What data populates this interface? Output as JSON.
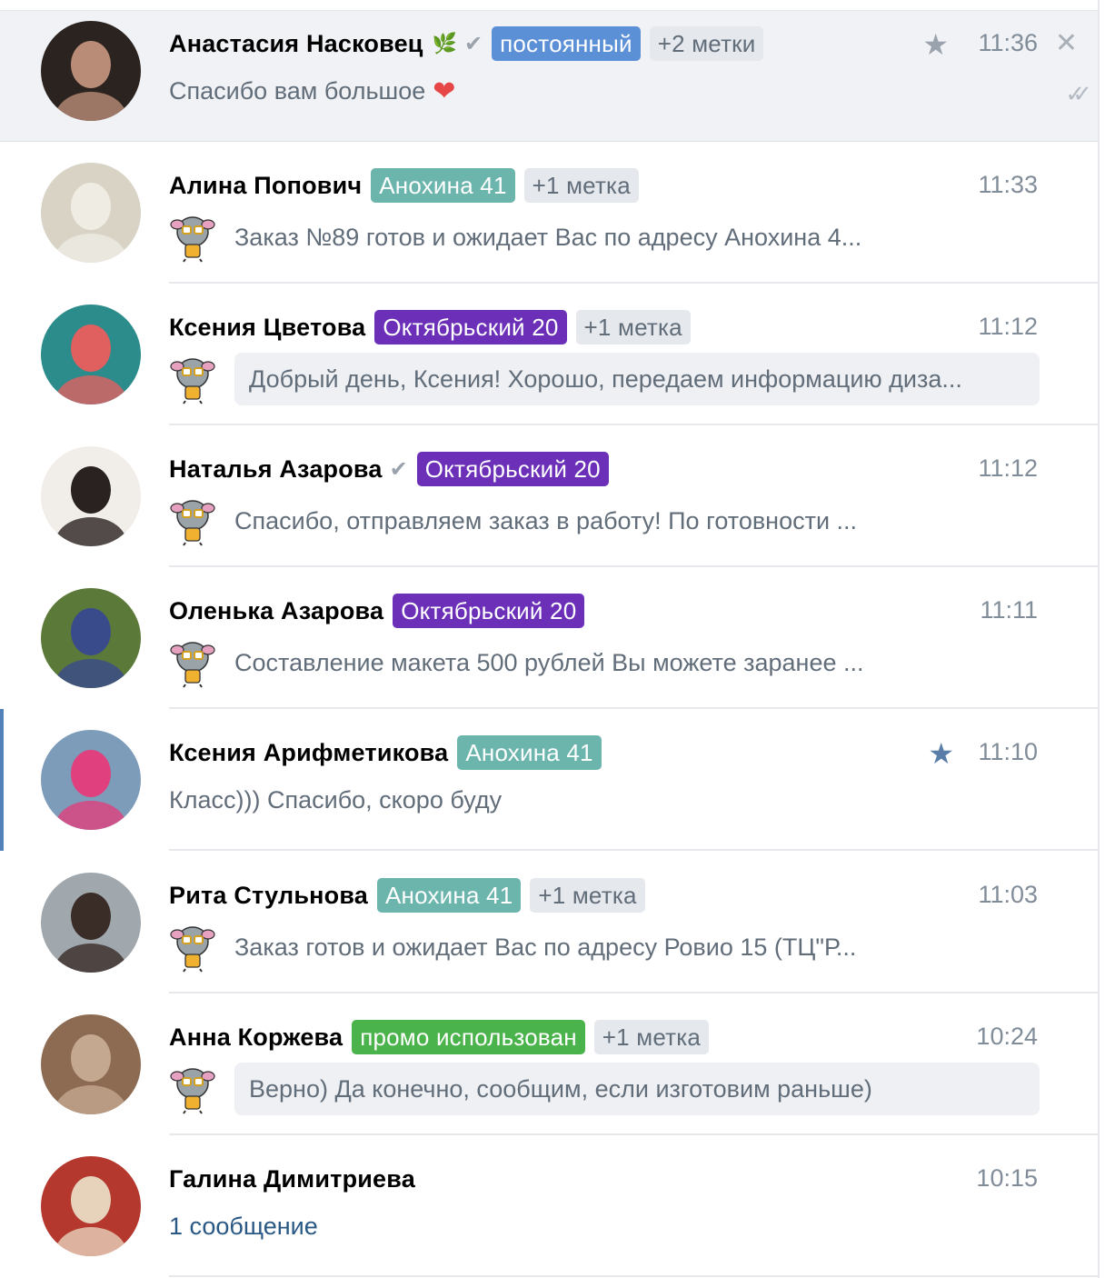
{
  "chats": [
    {
      "name": "Анастасия Насковец",
      "leaf": true,
      "verified": true,
      "tags": [
        {
          "text": "постоянный",
          "color": "#5b8fd6"
        }
      ],
      "more": "+2 метки",
      "time": "11:36",
      "starred": true,
      "closable": true,
      "read": true,
      "message": "Спасибо вам большое",
      "emoji": "❤",
      "mascot": false,
      "bubble": false
    },
    {
      "name": "Алина Попович",
      "tags": [
        {
          "text": "Анохина 41",
          "color": "#6bb5ad"
        }
      ],
      "more": "+1 метка",
      "time": "11:33",
      "message": "Заказ №89 готов и ожидает Вас по адресу Анохина 4...",
      "mascot": true,
      "bubble": false
    },
    {
      "name": "Ксения Цветова",
      "tags": [
        {
          "text": "Октябрьский 20",
          "color": "#6b2fb8"
        }
      ],
      "more": "+1 метка",
      "time": "11:12",
      "message": "Добрый день, Ксения! Хорошо, передаем информацию диза...",
      "mascot": true,
      "bubble": true
    },
    {
      "name": "Наталья Азарова",
      "verified": true,
      "tags": [
        {
          "text": "Октябрьский 20",
          "color": "#6b2fb8"
        }
      ],
      "time": "11:12",
      "message": "Спасибо, отправляем заказ в работу! По готовности ...",
      "mascot": true,
      "bubble": false
    },
    {
      "name": "Оленька Азарова",
      "tags": [
        {
          "text": "Октябрьский 20",
          "color": "#6b2fb8"
        }
      ],
      "time": "11:11",
      "message": "Составление макета 500 рублей Вы можете заранее ...",
      "mascot": true,
      "bubble": false
    },
    {
      "name": "Ксения Арифметикова",
      "tags": [
        {
          "text": "Анохина 41",
          "color": "#6bb5ad"
        }
      ],
      "time": "11:10",
      "starred": true,
      "star_blue": true,
      "marked": true,
      "message": "Класс))) Спасибо, скоро буду",
      "mascot": false,
      "bubble": false
    },
    {
      "name": "Рита Стульнова",
      "tags": [
        {
          "text": "Анохина 41",
          "color": "#6bb5ad"
        }
      ],
      "more": "+1 метка",
      "time": "11:03",
      "message": "Заказ готов и ожидает Вас по адресу Ровио 15 (ТЦ\"Р...",
      "mascot": true,
      "bubble": false
    },
    {
      "name": "Анна Коржева",
      "tags": [
        {
          "text": "промо использован",
          "color": "#4bb34b"
        }
      ],
      "more": "+1 метка",
      "time": "10:24",
      "message": "Верно) Да конечно, сообщим, если изготовим раньше)",
      "mascot": true,
      "bubble": true
    },
    {
      "name": "Галина Димитриева",
      "tags": [],
      "time": "10:15",
      "message": "1 сообщение",
      "mascot": false,
      "bubble": false,
      "link": true
    }
  ],
  "icons": {
    "star": "star-icon",
    "close": "close-icon",
    "read": "double-check-icon",
    "verified": "check-icon",
    "leaf": "leaf-icon",
    "heart": "heart-icon",
    "mascot": "mascot-sticker-icon"
  }
}
